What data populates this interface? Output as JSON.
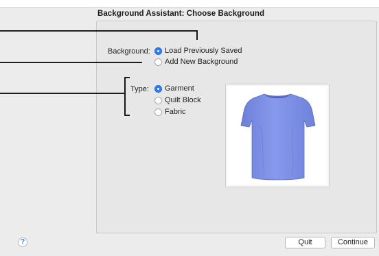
{
  "dialog": {
    "title": "Background Assistant: Choose Background"
  },
  "background": {
    "label": "Background:",
    "options": [
      {
        "label": "Load Previously Saved",
        "selected": true
      },
      {
        "label": "Add New Background",
        "selected": false
      }
    ]
  },
  "type": {
    "label": "Type:",
    "options": [
      {
        "label": "Garment",
        "selected": true
      },
      {
        "label": "Quilt Block",
        "selected": false
      },
      {
        "label": "Fabric",
        "selected": false
      }
    ]
  },
  "preview": {
    "image": "tshirt-garment-icon",
    "shirt_color": "#7f93e8"
  },
  "footer": {
    "help_label": "?",
    "quit_label": "Quit",
    "continue_label": "Continue"
  },
  "colors": {
    "accent": "#2e7cf6",
    "dialog_bg": "#ececec",
    "panel_bg": "#e7e7e7"
  }
}
